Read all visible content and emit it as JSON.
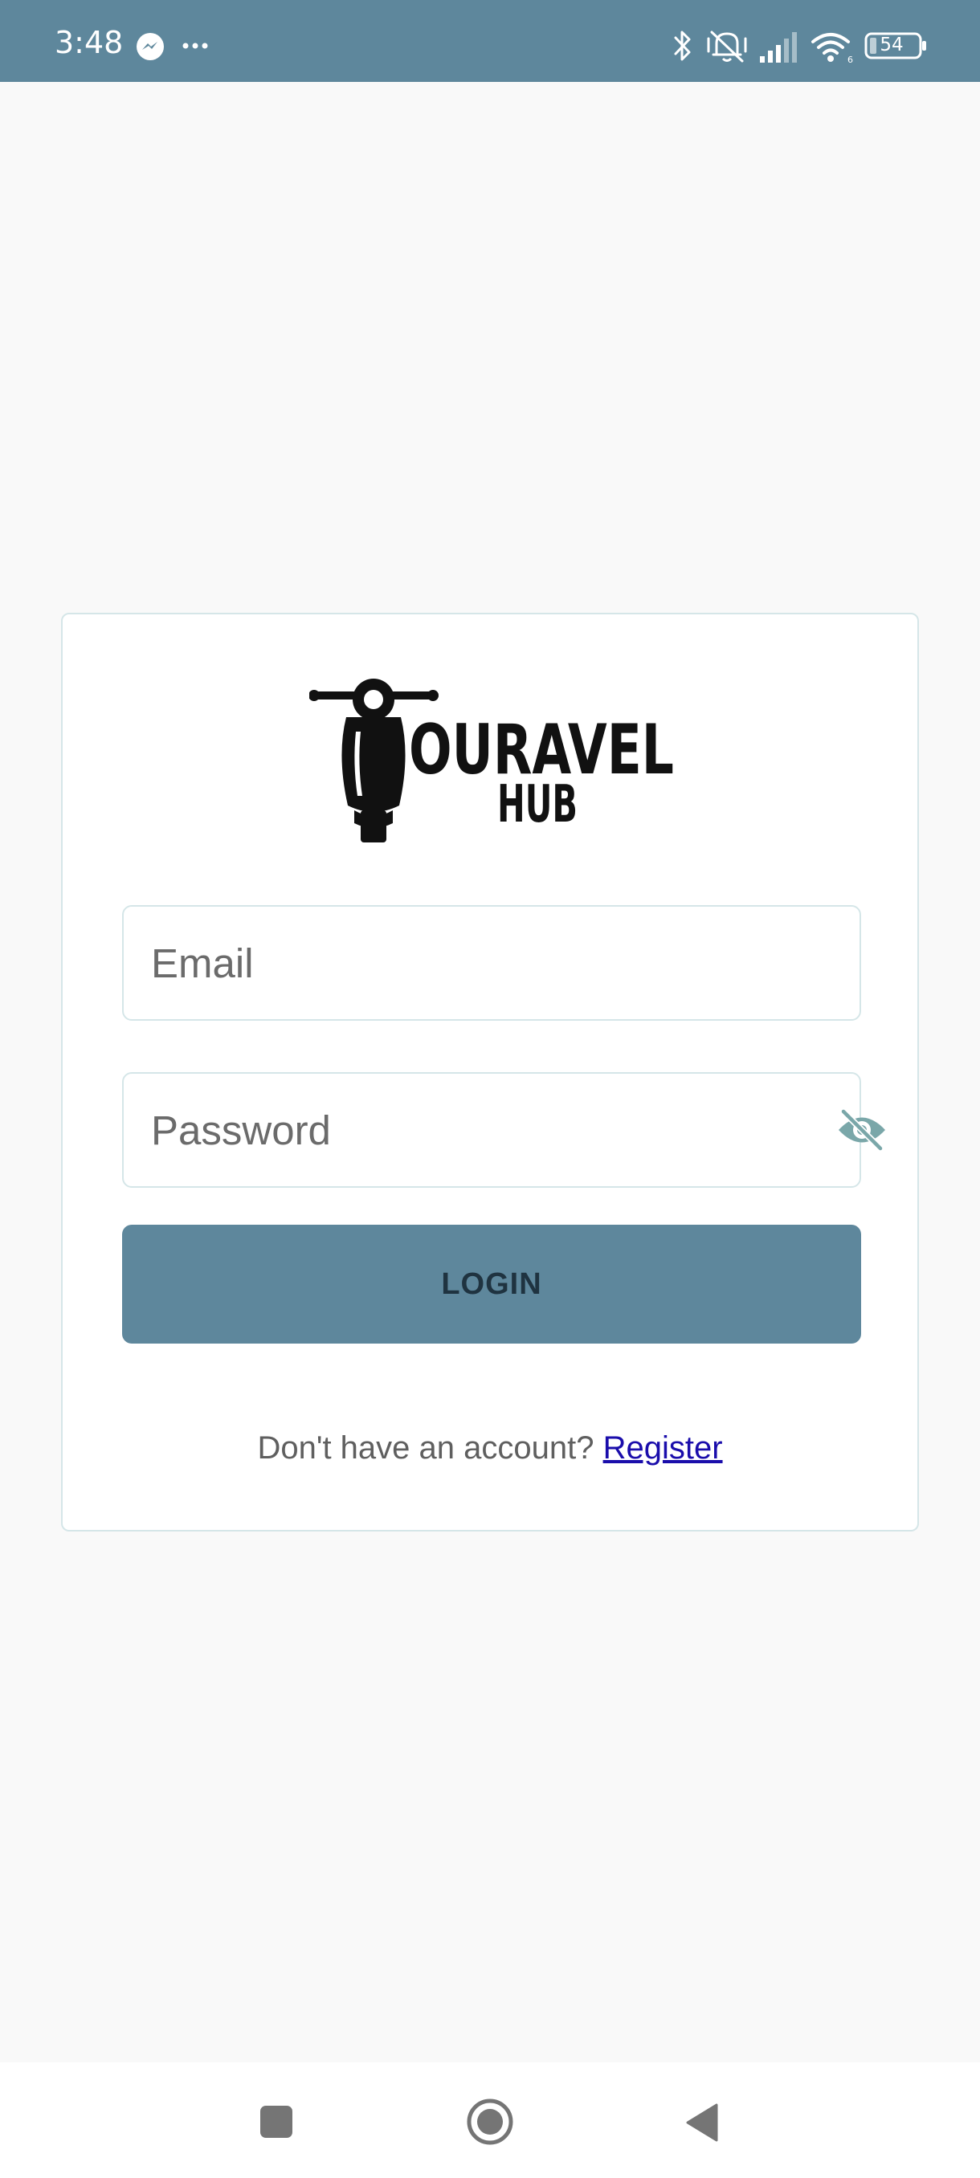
{
  "status_bar": {
    "time": "3:48",
    "battery_level": "54",
    "icons": [
      "messenger-icon",
      "more-dots-icon",
      "bluetooth-icon",
      "vibrate-icon",
      "signal-icon",
      "wifi-icon",
      "battery-icon"
    ],
    "background_color": "#5e879c"
  },
  "login": {
    "logo_text_main": "OURAVEL",
    "logo_text_sub": "HUB",
    "email_placeholder": "Email",
    "password_placeholder": "Password",
    "password_toggle_icon": "eye-off-icon",
    "login_label": "LOGIN",
    "register_prompt": "Don't have an account? ",
    "register_link": "Register",
    "accent_color": "#5e879c",
    "link_color": "#1a0dab"
  },
  "nav_bar": {
    "buttons": [
      "recents-square-icon",
      "home-circle-icon",
      "back-triangle-icon"
    ]
  }
}
